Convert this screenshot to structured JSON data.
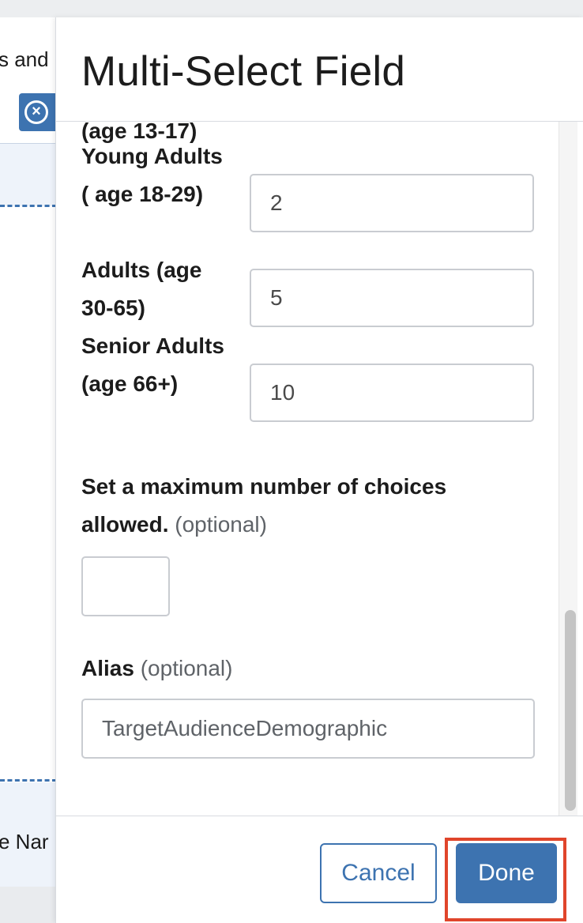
{
  "background": {
    "top_text": "s and",
    "bottom_text": "e Nar",
    "remove_icon": "close-circle-icon"
  },
  "modal": {
    "title": "Multi-Select Field",
    "cut_off_label": "(age 13-17)",
    "options": [
      {
        "label": "Young Adults ( age 18-29)",
        "value": "2"
      },
      {
        "label": "Adults (age 30-65)",
        "value": "5"
      },
      {
        "label": "Senior Adults (age 66+)",
        "value": "10"
      }
    ],
    "max_choices": {
      "label": "Set a maximum number of choices allowed.",
      "optional": "(optional)",
      "value": ""
    },
    "alias": {
      "label": "Alias",
      "optional": "(optional)",
      "value": "TargetAudienceDemographic"
    }
  },
  "footer": {
    "cancel_label": "Cancel",
    "done_label": "Done"
  },
  "colors": {
    "accent": "#3d73b0",
    "highlight": "#e0452b"
  }
}
